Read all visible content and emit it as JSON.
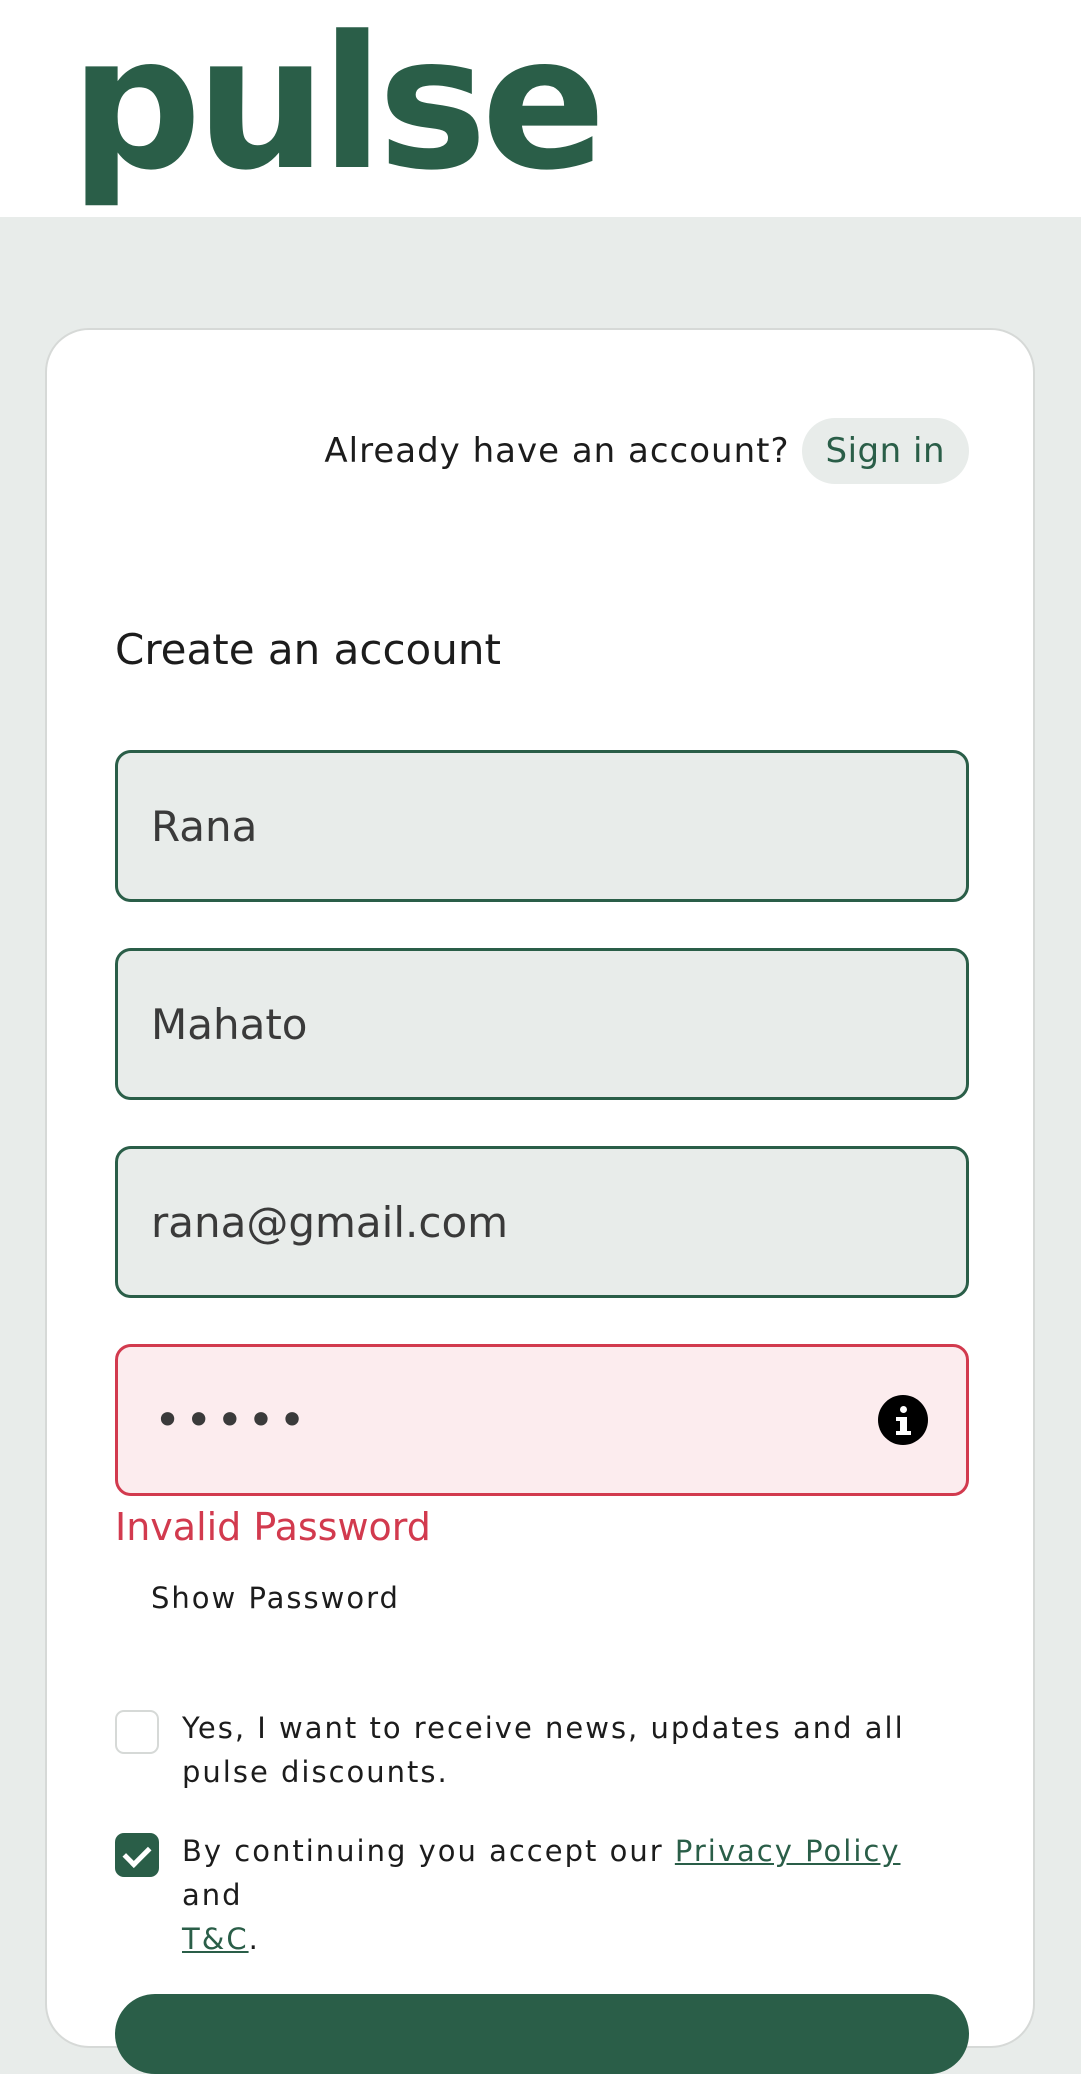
{
  "brand": {
    "logo_text": "pulse",
    "accent_color": "#2a5e48",
    "error_color": "#d23a4e"
  },
  "auth_prompt": {
    "question": "Already have an account?",
    "signin_label": "Sign in"
  },
  "form": {
    "title": "Create an account",
    "first_name": "Rana",
    "last_name": "Mahato",
    "email": "rana@gmail.com",
    "password_masked": "•••••",
    "password_error": "Invalid Password",
    "show_password_label": "Show Password",
    "newsletter": {
      "checked": false,
      "label": "Yes, I want to receive news, updates and all pulse discounts."
    },
    "terms": {
      "checked": true,
      "prefix": "By continuing you accept our ",
      "privacy_link": "Privacy Policy",
      "middle": " and",
      "tc_link": "T&C",
      "suffix": "."
    }
  },
  "icons": {
    "password_info": "info-icon",
    "terms_check": "checkmark-icon"
  }
}
